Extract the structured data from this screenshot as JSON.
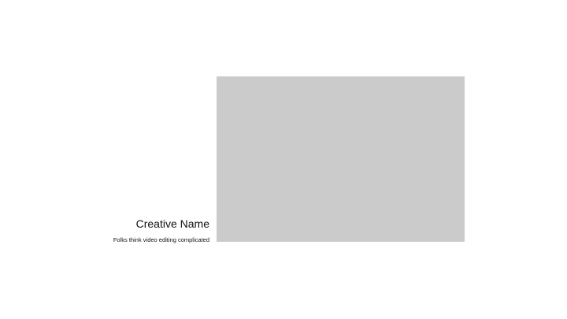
{
  "caption": {
    "title": "Creative Name",
    "subtitle": "Folks think video editing complicated"
  },
  "colors": {
    "background": "#ffffff",
    "placeholder": "#cbcbcb",
    "text": "#111111"
  }
}
